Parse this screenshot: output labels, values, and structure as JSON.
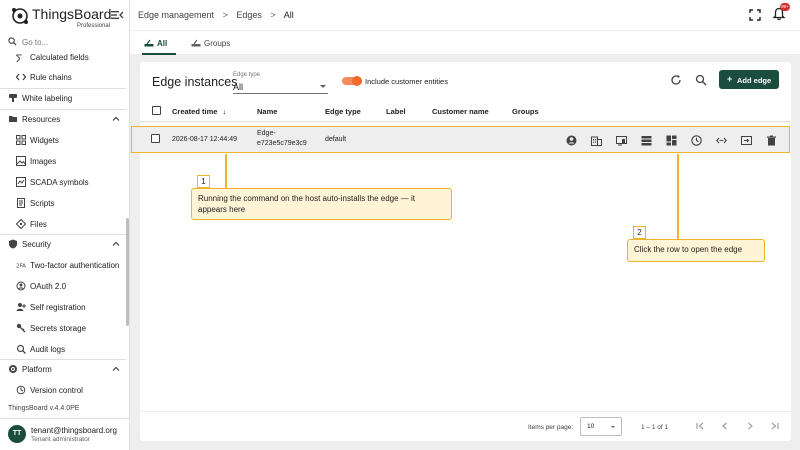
{
  "app": {
    "logo_text": "ThingsBoard",
    "logo_subtext": "Professional",
    "version": "ThingsBoard v.4.4.0PE"
  },
  "sidebar": {
    "search_placeholder": "Go to...",
    "items": [
      {
        "label": "Calculated fields",
        "icon": "calculated-fields-icon"
      },
      {
        "label": "Rule chains",
        "icon": "rule-chains-icon"
      },
      {
        "label": "White labeling",
        "icon": "white-labeling-icon"
      },
      {
        "label": "Resources",
        "icon": "resources-icon"
      },
      {
        "label": "Widgets",
        "icon": "widgets-icon"
      },
      {
        "label": "Images",
        "icon": "images-icon"
      },
      {
        "label": "SCADA symbols",
        "icon": "scada-icon"
      },
      {
        "label": "Scripts",
        "icon": "scripts-icon"
      },
      {
        "label": "Files",
        "icon": "files-icon"
      },
      {
        "label": "Security",
        "icon": "security-icon"
      },
      {
        "label": "Two-factor authentication",
        "icon": "two-factor-icon"
      },
      {
        "label": "OAuth 2.0",
        "icon": "oauth-icon"
      },
      {
        "label": "Self registration",
        "icon": "self-registration-icon"
      },
      {
        "label": "Secrets storage",
        "icon": "secrets-storage-icon"
      },
      {
        "label": "Audit logs",
        "icon": "audit-logs-icon"
      },
      {
        "label": "Platform",
        "icon": "platform-icon"
      },
      {
        "label": "Version control",
        "icon": "version-control-icon"
      }
    ]
  },
  "user": {
    "initials": "TT",
    "email": "tenant@thingsboard.org",
    "role": "Tenant administrator"
  },
  "header": {
    "breadcrumb": [
      "Edge management",
      "Edges",
      "All"
    ],
    "breadcrumb_sep": ">",
    "notification_badge": "99+"
  },
  "tabs": [
    {
      "label": "All",
      "active": true
    },
    {
      "label": "Groups",
      "active": false
    }
  ],
  "table": {
    "title": "Edge instances",
    "edge_type_label": "Edge type",
    "edge_type_value": "All",
    "include_customer_label": "Include customer entities",
    "add_button_label": "Add edge",
    "add_button_plus": "+",
    "columns": [
      "Created time",
      "Name",
      "Edge type",
      "Label",
      "Customer name",
      "Groups"
    ],
    "sort_indicator": "↓",
    "rows": [
      {
        "created_time": "2026-08-17 12:44:49",
        "name_line1": "Edge-",
        "name_line2": "e723e5c79e3c9",
        "edge_type": "default",
        "label": "",
        "customer_name": "",
        "groups": ""
      }
    ]
  },
  "callouts": [
    {
      "number": "1",
      "text": "Running the command on the host auto-installs the edge — it appears here"
    },
    {
      "number": "2",
      "text": "Click the row to open the edge"
    }
  ],
  "pagination": {
    "items_per_page_label": "Items per page:",
    "items_per_page_value": "10",
    "range": "1 – 1 of 1"
  },
  "colors": {
    "brand": "#1b4d3e",
    "highlight": "#f0b429",
    "callout_bg": "#fff4d6",
    "toggle": "#ef6c2e"
  }
}
